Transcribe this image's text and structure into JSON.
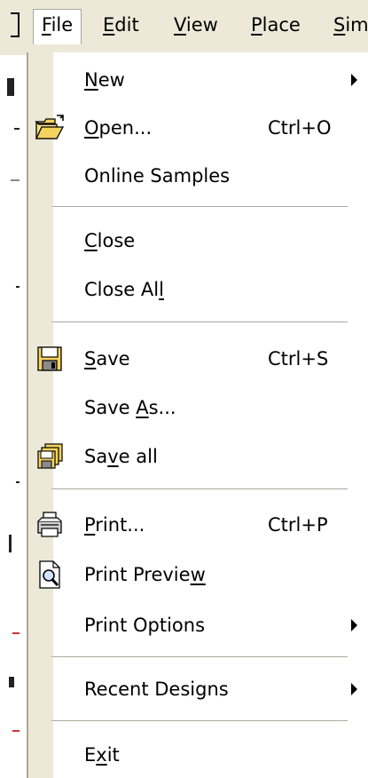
{
  "menubar": {
    "items": [
      "File",
      "Edit",
      "View",
      "Place",
      "Sim"
    ],
    "active": "File"
  },
  "file_menu": {
    "new": {
      "label": "New"
    },
    "open": {
      "label": "Open...",
      "shortcut": "Ctrl+O"
    },
    "online_samples": {
      "label": "Online Samples"
    },
    "close": {
      "label": "Close"
    },
    "close_all": {
      "label": "Close All"
    },
    "save": {
      "label": "Save",
      "shortcut": "Ctrl+S"
    },
    "save_as": {
      "label": "Save As..."
    },
    "save_all": {
      "label": "Save all"
    },
    "print": {
      "label": "Print...",
      "shortcut": "Ctrl+P"
    },
    "print_preview": {
      "label": "Print Preview"
    },
    "print_options": {
      "label": "Print Options"
    },
    "recent_designs": {
      "label": "Recent Designs"
    },
    "exit": {
      "label": "Exit"
    }
  },
  "icons": {
    "open": "folder-open-icon",
    "save": "floppy-disk-icon",
    "save_all": "multi-floppy-icon",
    "print": "printer-icon",
    "print_preview": "print-preview-icon"
  },
  "colors": {
    "menu_background": "#ffffff",
    "menubar_background": "#ece9d8",
    "separator": "#aca899"
  }
}
